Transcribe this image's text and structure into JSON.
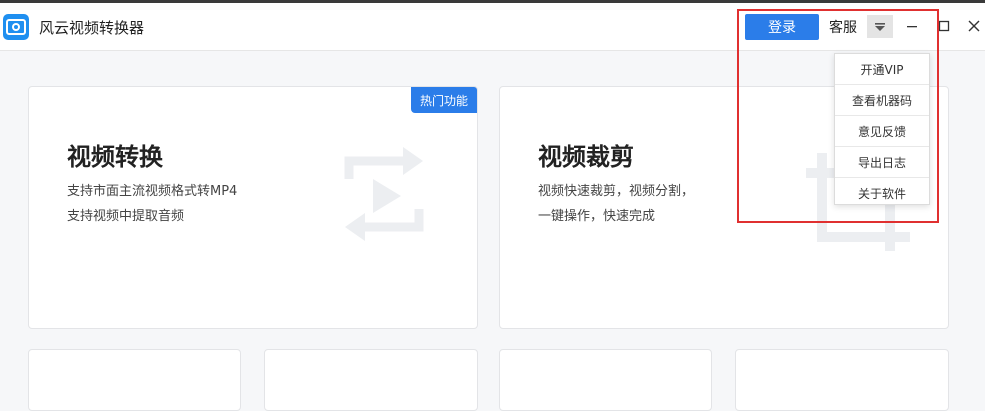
{
  "app": {
    "title": "风云视频转换器"
  },
  "header": {
    "login_label": "登录",
    "service_label": "客服"
  },
  "icons": {
    "logo": "play-logo-icon",
    "dropdown": "caret-down-icon",
    "minimize": "minimize-icon",
    "maximize": "maximize-icon",
    "close": "close-icon"
  },
  "cards": [
    {
      "badge": "热门功能",
      "title": "视频转换",
      "lines": [
        "支持市面主流视频格式转MP4",
        "支持视频中提取音频"
      ],
      "icon": "convert-play-icon"
    },
    {
      "title": "视频裁剪",
      "lines": [
        "视频快速裁剪，视频分割，",
        "一键操作，快速完成"
      ],
      "icon": "crop-icon"
    }
  ],
  "menu": {
    "items": [
      {
        "label": "开通VIP"
      },
      {
        "label": "查看机器码"
      },
      {
        "label": "意见反馈"
      },
      {
        "label": "导出日志"
      },
      {
        "label": "关于软件"
      }
    ]
  },
  "colors": {
    "accent": "#2b7de9",
    "highlight": "#e03030"
  }
}
